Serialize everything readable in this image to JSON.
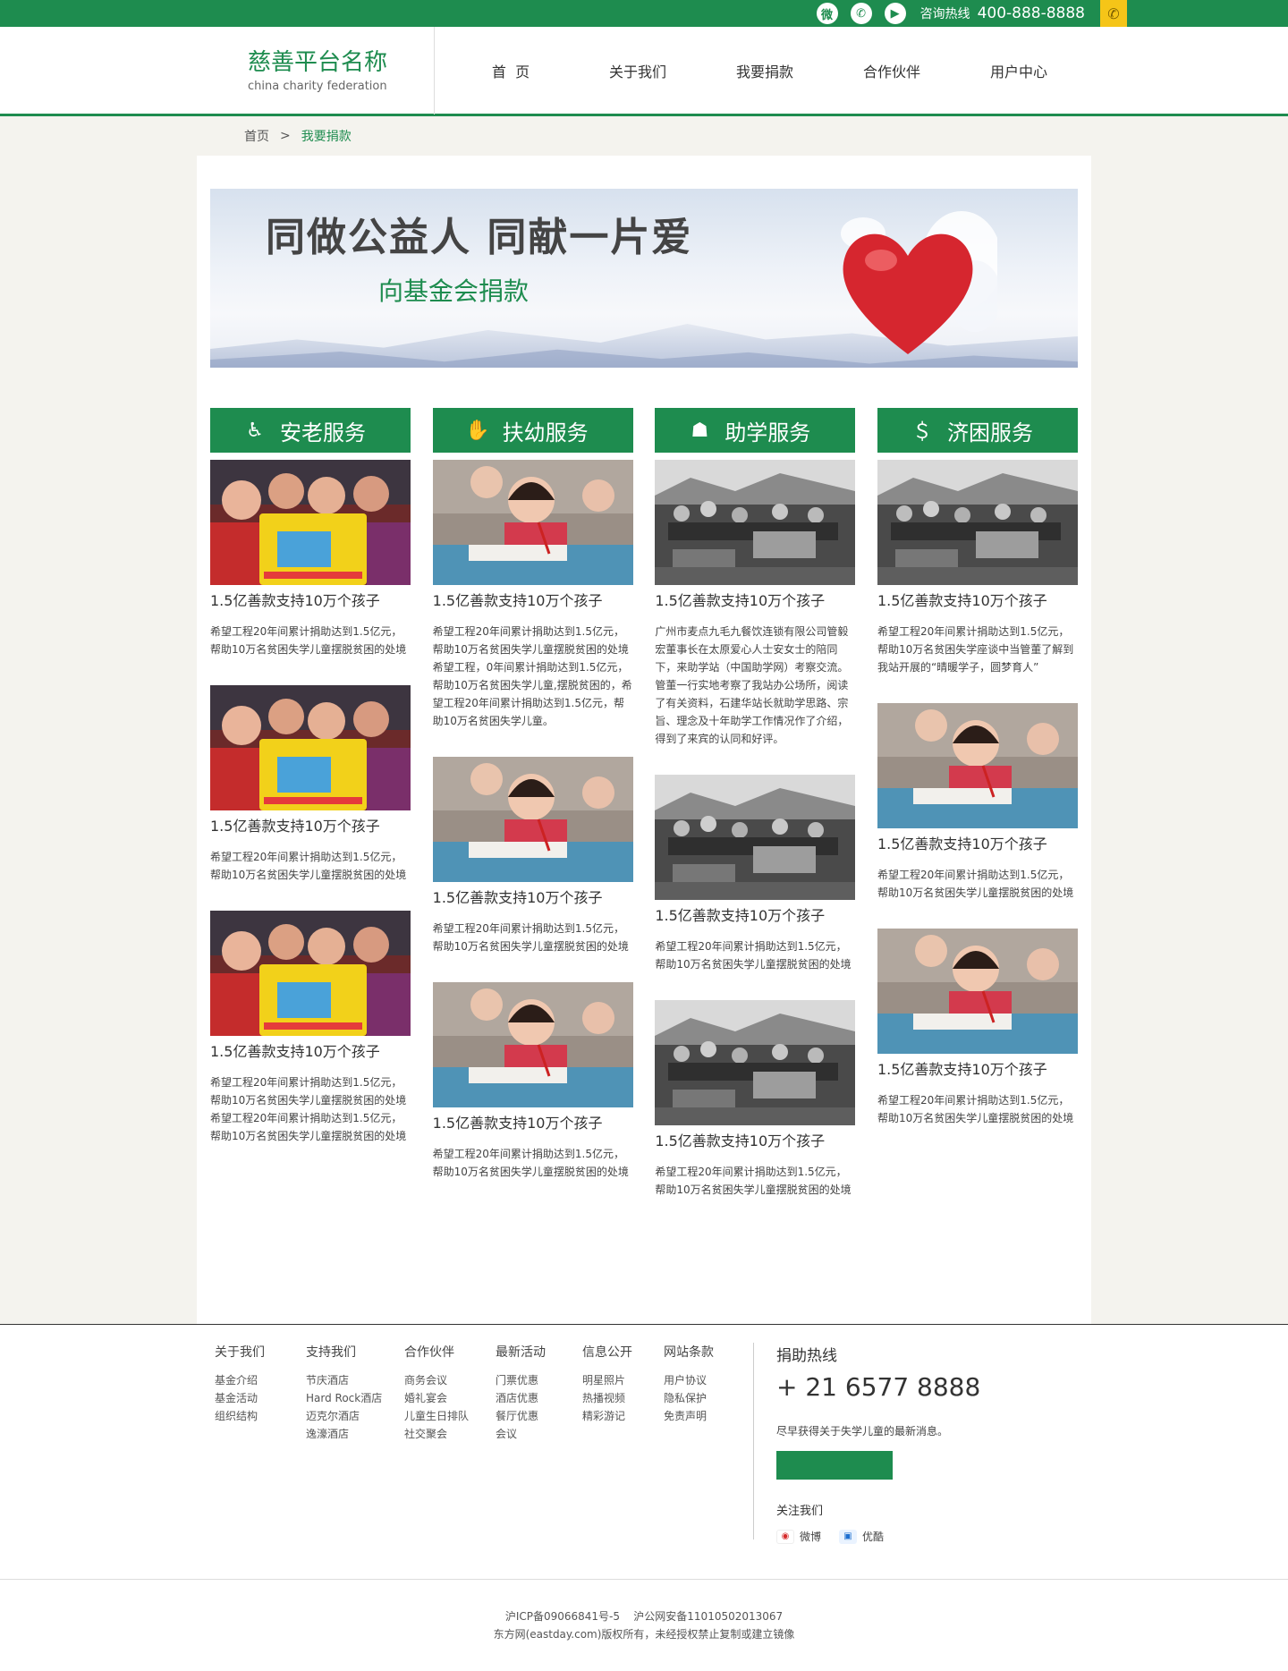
{
  "topbar": {
    "icons": [
      "weibo-icon",
      "wechat-icon",
      "video-icon"
    ],
    "hotline_label": "咨询热线",
    "hotline_number": "400-888-8888"
  },
  "header": {
    "logo_cn": "慈善平台名称",
    "logo_en": "china charity federation",
    "nav": [
      "首  页",
      "关于我们",
      "我要捐款",
      "合作伙伴",
      "用户中心"
    ]
  },
  "breadcrumb": {
    "home": "首页",
    "separator": ">",
    "current": "我要捐款"
  },
  "banner": {
    "title": "同做公益人 同献一片爱",
    "subtitle": "向基金会捐款"
  },
  "categories": [
    {
      "title": "安老服务",
      "icon": "elderly-icon",
      "cards": [
        {
          "photo": "kids-crayons",
          "title": "1.5亿善款支持10万个孩子",
          "desc": "希望工程20年间累计捐助达到1.5亿元，帮助10万名贫困失学儿童摆脱贫困的处境"
        },
        {
          "photo": "kids-crayons",
          "title": "1.5亿善款支持10万个孩子",
          "desc": "希望工程20年间累计捐助达到1.5亿元，帮助10万名贫困失学儿童摆脱贫困的处境"
        },
        {
          "photo": "kids-crayons",
          "title": "1.5亿善款支持10万个孩子",
          "desc": "希望工程20年间累计捐助达到1.5亿元，帮助10万名贫困失学儿童摆脱贫困的处境希望工程20年间累计捐助达到1.5亿元，帮助10万名贫困失学儿童摆脱贫困的处境"
        }
      ]
    },
    {
      "title": "扶幼服务",
      "icon": "helping-hands-icon",
      "cards": [
        {
          "photo": "girl-desk",
          "title": "1.5亿善款支持10万个孩子",
          "desc": "希望工程20年间累计捐助达到1.5亿元，帮助10万名贫困失学儿童摆脱贫困的处境希望工程，0年间累计捐助达到1.5亿元，帮助10万名贫困失学儿童,摆脱贫困的，希望工程20年间累计捐助达到1.5亿元，帮助10万名贫困失学儿童。"
        },
        {
          "photo": "girl-desk",
          "title": "1.5亿善款支持10万个孩子",
          "desc": "希望工程20年间累计捐助达到1.5亿元，帮助10万名贫困失学儿童摆脱贫困的处境"
        },
        {
          "photo": "girl-desk",
          "title": "1.5亿善款支持10万个孩子",
          "desc": "希望工程20年间累计捐助达到1.5亿元，帮助10万名贫困失学儿童摆脱贫困的处境"
        }
      ]
    },
    {
      "title": "助学服务",
      "icon": "student-icon",
      "cards": [
        {
          "photo": "outdoor-class-bw",
          "title": "1.5亿善款支持10万个孩子",
          "desc": "广州市麦点九毛九餐饮连锁有限公司管毅宏董事长在太原爱心人士安女士的陪同下，来助学站（中国助学网）考察交流。管董一行实地考察了我站办公场所，阅读了有关资料，石建华站长就助学思路、宗旨、理念及十年助学工作情况作了介绍，得到了来宾的认同和好评。"
        },
        {
          "photo": "outdoor-class-bw",
          "title": "1.5亿善款支持10万个孩子",
          "desc": "希望工程20年间累计捐助达到1.5亿元，帮助10万名贫困失学儿童摆脱贫困的处境"
        },
        {
          "photo": "outdoor-class-bw",
          "title": "1.5亿善款支持10万个孩子",
          "desc": "希望工程20年间累计捐助达到1.5亿元，帮助10万名贫困失学儿童摆脱贫困的处境"
        }
      ]
    },
    {
      "title": "济困服务",
      "icon": "donation-hand-icon",
      "cards": [
        {
          "photo": "outdoor-class-bw",
          "title": "1.5亿善款支持10万个孩子",
          "desc": "希望工程20年间累计捐助达到1.5亿元，帮助10万名贫困失学座谈中当管董了解到我站开展的“晴暖学子，圆梦育人”"
        },
        {
          "photo": "girl-desk",
          "title": "1.5亿善款支持10万个孩子",
          "desc": "希望工程20年间累计捐助达到1.5亿元，帮助10万名贫困失学儿童摆脱贫困的处境"
        },
        {
          "photo": "girl-desk",
          "title": "1.5亿善款支持10万个孩子",
          "desc": "希望工程20年间累计捐助达到1.5亿元，帮助10万名贫困失学儿童摆脱贫困的处境"
        }
      ]
    }
  ],
  "footer": {
    "columns": [
      {
        "title": "关于我们",
        "links": [
          "基金介绍",
          "基金活动",
          "组织结构"
        ]
      },
      {
        "title": "支持我们",
        "links": [
          "节庆酒店",
          "Hard Rock酒店",
          "迈克尔酒店",
          "逸濠酒店"
        ]
      },
      {
        "title": "合作伙伴",
        "links": [
          "商务会议",
          "婚礼宴会",
          "儿童生日排队",
          "社交聚会"
        ]
      },
      {
        "title": "最新活动",
        "links": [
          "门票优惠",
          "酒店优惠",
          "餐厅优惠",
          "会议"
        ]
      },
      {
        "title": "信息公开",
        "links": [
          "明星照片",
          "热播视频",
          "精彩游记"
        ]
      },
      {
        "title": "网站条款",
        "links": [
          "用户协议",
          "隐私保护",
          "免责声明"
        ]
      }
    ],
    "hotline_title": "捐助热线",
    "hotline_number": "+ 21 6577 8888",
    "news_text": "尽早获得关于失学儿童的最新消息。",
    "follow_title": "关注我们",
    "social": [
      {
        "icon": "weibo-icon",
        "label": "微博"
      },
      {
        "icon": "youku-icon",
        "label": "优酷"
      }
    ]
  },
  "copyright": {
    "line1": "沪ICP备09066841号-5    沪公网安备11010502013067",
    "line2": "东方网(eastday.com)版权所有，未经授权禁止复制或建立镜像"
  }
}
